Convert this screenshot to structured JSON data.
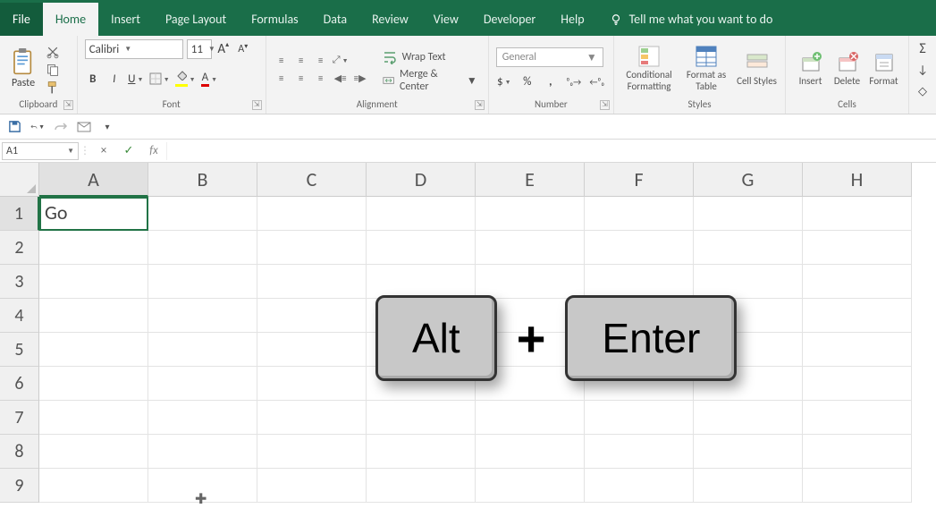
{
  "tabs": {
    "file": "File",
    "home": "Home",
    "insert": "Insert",
    "page_layout": "Page Layout",
    "formulas": "Formulas",
    "data": "Data",
    "review": "Review",
    "view": "View",
    "developer": "Developer",
    "help": "Help",
    "tell_me": "Tell me what you want to do"
  },
  "ribbon": {
    "clipboard": {
      "label": "Clipboard",
      "paste": "Paste"
    },
    "font": {
      "label": "Font",
      "name": "Calibri",
      "size": "11",
      "bold": "B",
      "italic": "I",
      "underline": "U",
      "A_large": "A",
      "A_small": "A",
      "font_color_letter": "A"
    },
    "alignment": {
      "label": "Alignment",
      "wrap": "Wrap Text",
      "merge": "Merge & Center"
    },
    "number": {
      "label": "Number",
      "format": "General",
      "currency": "$",
      "percent": "%",
      "comma": ",",
      "inc": ".0",
      "dec": ".00"
    },
    "styles": {
      "label": "Styles",
      "conditional": "Conditional Formatting",
      "format_as": "Format as Table",
      "cell_styles": "Cell Styles"
    },
    "cells": {
      "label": "Cells",
      "insert": "Insert",
      "delete": "Delete",
      "format": "Format"
    }
  },
  "fbar": {
    "namebox": "A1",
    "cancel": "×",
    "enter": "✓",
    "fx": "fx",
    "formula": ""
  },
  "columns": [
    "A",
    "B",
    "C",
    "D",
    "E",
    "F",
    "G",
    "H"
  ],
  "rows": [
    "1",
    "2",
    "3",
    "4",
    "5",
    "6",
    "7",
    "8",
    "9"
  ],
  "cell_A1": "Go",
  "overlay": {
    "key1": "Alt",
    "plus": "+",
    "key2": "Enter"
  }
}
